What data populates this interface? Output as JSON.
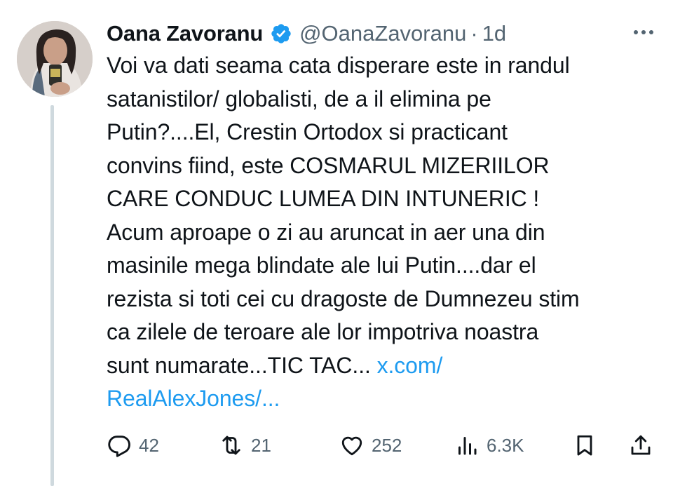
{
  "tweet": {
    "author_name": "Oana Zavoranu",
    "handle": "@OanaZavoranu",
    "separator": "·",
    "time": "1d",
    "text_lines": [
      "Voi va dati seama cata disperare este in randul",
      "satanistilor/ globalisti, de a il elimina pe",
      "Putin?....El, Crestin Ortodox si practicant",
      "convins fiind, este COSMARUL MIZERIILOR",
      "CARE CONDUC LUMEA DIN INTUNERIC !",
      "Acum aproape o zi au aruncat in aer una din",
      "masinile mega blindate ale lui Putin....dar el",
      "rezista si toti cei cu dragoste de Dumnezeu stim",
      "ca zilele de teroare ale lor impotriva noastra",
      "sunt numarate...TIC TAC..."
    ],
    "link_part1": "x.com/",
    "link_part2": "RealAlexJones/..."
  },
  "actions": {
    "replies": "42",
    "reposts": "21",
    "likes": "252",
    "views": "6.3K"
  },
  "colors": {
    "text": "#0f1419",
    "secondary": "#536471",
    "link": "#1d9bf0",
    "verified": "#1d9bf0",
    "thread_line": "#cfd9de"
  },
  "icons": [
    "verified-badge-icon",
    "more-options-icon",
    "reply-icon",
    "repost-icon",
    "like-icon",
    "views-icon",
    "bookmark-icon",
    "share-icon"
  ]
}
